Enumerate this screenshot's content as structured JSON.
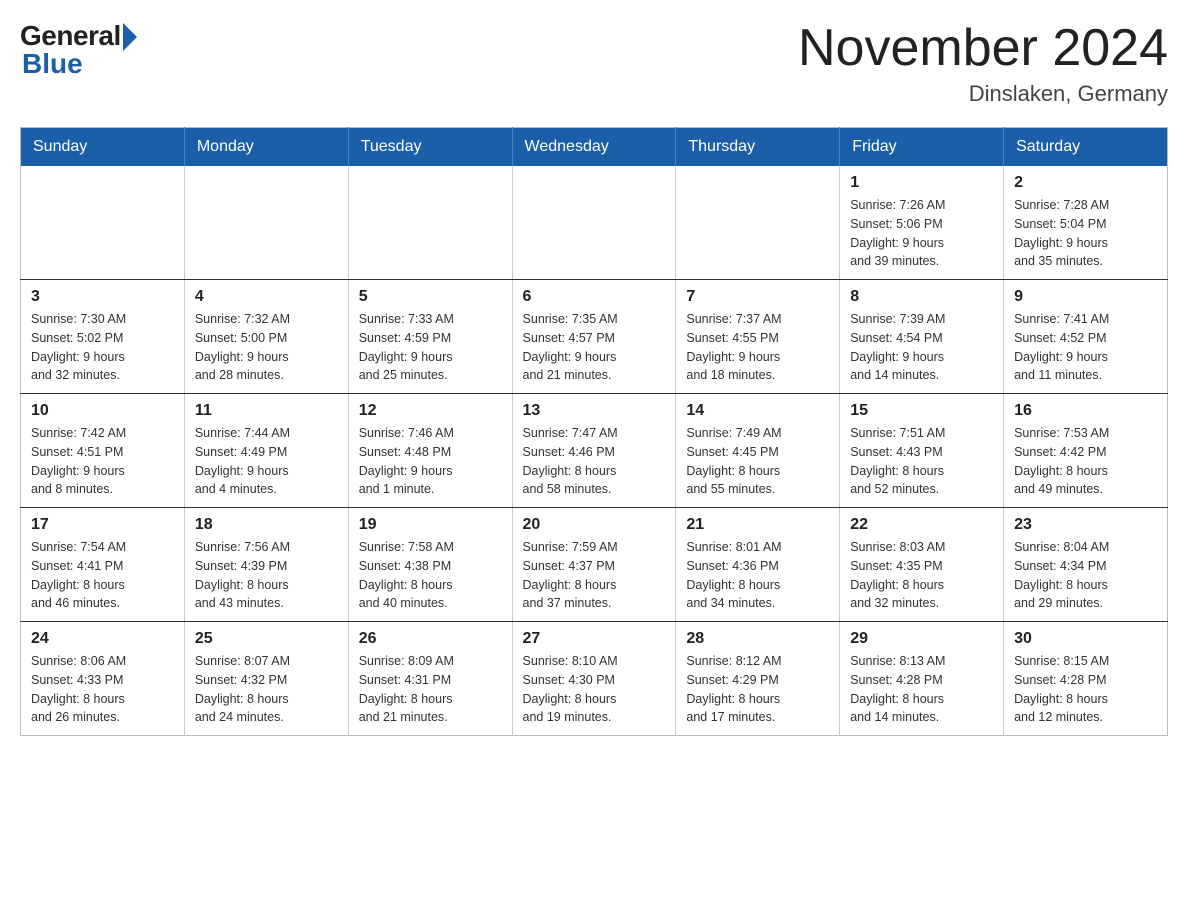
{
  "logo": {
    "general": "General",
    "blue": "Blue"
  },
  "title": "November 2024",
  "subtitle": "Dinslaken, Germany",
  "days_of_week": [
    "Sunday",
    "Monday",
    "Tuesday",
    "Wednesday",
    "Thursday",
    "Friday",
    "Saturday"
  ],
  "weeks": [
    [
      {
        "day": "",
        "info": ""
      },
      {
        "day": "",
        "info": ""
      },
      {
        "day": "",
        "info": ""
      },
      {
        "day": "",
        "info": ""
      },
      {
        "day": "",
        "info": ""
      },
      {
        "day": "1",
        "info": "Sunrise: 7:26 AM\nSunset: 5:06 PM\nDaylight: 9 hours\nand 39 minutes."
      },
      {
        "day": "2",
        "info": "Sunrise: 7:28 AM\nSunset: 5:04 PM\nDaylight: 9 hours\nand 35 minutes."
      }
    ],
    [
      {
        "day": "3",
        "info": "Sunrise: 7:30 AM\nSunset: 5:02 PM\nDaylight: 9 hours\nand 32 minutes."
      },
      {
        "day": "4",
        "info": "Sunrise: 7:32 AM\nSunset: 5:00 PM\nDaylight: 9 hours\nand 28 minutes."
      },
      {
        "day": "5",
        "info": "Sunrise: 7:33 AM\nSunset: 4:59 PM\nDaylight: 9 hours\nand 25 minutes."
      },
      {
        "day": "6",
        "info": "Sunrise: 7:35 AM\nSunset: 4:57 PM\nDaylight: 9 hours\nand 21 minutes."
      },
      {
        "day": "7",
        "info": "Sunrise: 7:37 AM\nSunset: 4:55 PM\nDaylight: 9 hours\nand 18 minutes."
      },
      {
        "day": "8",
        "info": "Sunrise: 7:39 AM\nSunset: 4:54 PM\nDaylight: 9 hours\nand 14 minutes."
      },
      {
        "day": "9",
        "info": "Sunrise: 7:41 AM\nSunset: 4:52 PM\nDaylight: 9 hours\nand 11 minutes."
      }
    ],
    [
      {
        "day": "10",
        "info": "Sunrise: 7:42 AM\nSunset: 4:51 PM\nDaylight: 9 hours\nand 8 minutes."
      },
      {
        "day": "11",
        "info": "Sunrise: 7:44 AM\nSunset: 4:49 PM\nDaylight: 9 hours\nand 4 minutes."
      },
      {
        "day": "12",
        "info": "Sunrise: 7:46 AM\nSunset: 4:48 PM\nDaylight: 9 hours\nand 1 minute."
      },
      {
        "day": "13",
        "info": "Sunrise: 7:47 AM\nSunset: 4:46 PM\nDaylight: 8 hours\nand 58 minutes."
      },
      {
        "day": "14",
        "info": "Sunrise: 7:49 AM\nSunset: 4:45 PM\nDaylight: 8 hours\nand 55 minutes."
      },
      {
        "day": "15",
        "info": "Sunrise: 7:51 AM\nSunset: 4:43 PM\nDaylight: 8 hours\nand 52 minutes."
      },
      {
        "day": "16",
        "info": "Sunrise: 7:53 AM\nSunset: 4:42 PM\nDaylight: 8 hours\nand 49 minutes."
      }
    ],
    [
      {
        "day": "17",
        "info": "Sunrise: 7:54 AM\nSunset: 4:41 PM\nDaylight: 8 hours\nand 46 minutes."
      },
      {
        "day": "18",
        "info": "Sunrise: 7:56 AM\nSunset: 4:39 PM\nDaylight: 8 hours\nand 43 minutes."
      },
      {
        "day": "19",
        "info": "Sunrise: 7:58 AM\nSunset: 4:38 PM\nDaylight: 8 hours\nand 40 minutes."
      },
      {
        "day": "20",
        "info": "Sunrise: 7:59 AM\nSunset: 4:37 PM\nDaylight: 8 hours\nand 37 minutes."
      },
      {
        "day": "21",
        "info": "Sunrise: 8:01 AM\nSunset: 4:36 PM\nDaylight: 8 hours\nand 34 minutes."
      },
      {
        "day": "22",
        "info": "Sunrise: 8:03 AM\nSunset: 4:35 PM\nDaylight: 8 hours\nand 32 minutes."
      },
      {
        "day": "23",
        "info": "Sunrise: 8:04 AM\nSunset: 4:34 PM\nDaylight: 8 hours\nand 29 minutes."
      }
    ],
    [
      {
        "day": "24",
        "info": "Sunrise: 8:06 AM\nSunset: 4:33 PM\nDaylight: 8 hours\nand 26 minutes."
      },
      {
        "day": "25",
        "info": "Sunrise: 8:07 AM\nSunset: 4:32 PM\nDaylight: 8 hours\nand 24 minutes."
      },
      {
        "day": "26",
        "info": "Sunrise: 8:09 AM\nSunset: 4:31 PM\nDaylight: 8 hours\nand 21 minutes."
      },
      {
        "day": "27",
        "info": "Sunrise: 8:10 AM\nSunset: 4:30 PM\nDaylight: 8 hours\nand 19 minutes."
      },
      {
        "day": "28",
        "info": "Sunrise: 8:12 AM\nSunset: 4:29 PM\nDaylight: 8 hours\nand 17 minutes."
      },
      {
        "day": "29",
        "info": "Sunrise: 8:13 AM\nSunset: 4:28 PM\nDaylight: 8 hours\nand 14 minutes."
      },
      {
        "day": "30",
        "info": "Sunrise: 8:15 AM\nSunset: 4:28 PM\nDaylight: 8 hours\nand 12 minutes."
      }
    ]
  ]
}
